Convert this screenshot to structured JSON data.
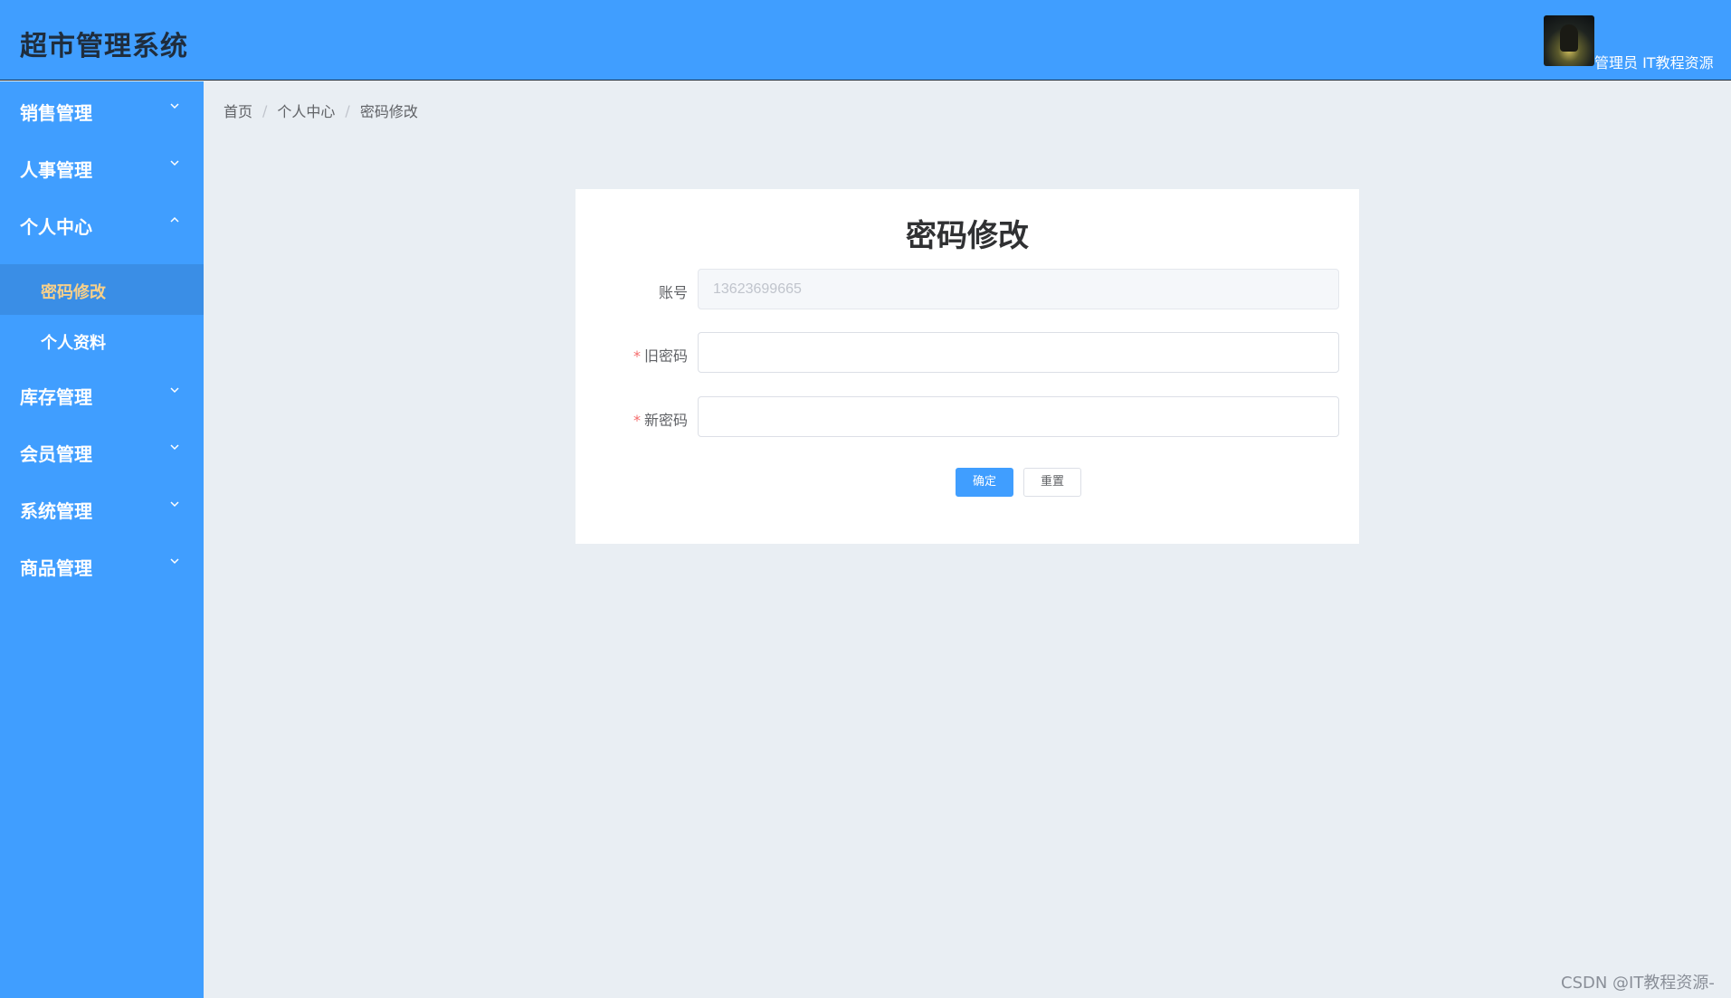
{
  "header": {
    "title": "超市管理系统",
    "user_label": "管理员 IT教程资源"
  },
  "sidebar": {
    "items": [
      {
        "label": "销售管理",
        "expanded": false,
        "icon": "chevron-down-icon"
      },
      {
        "label": "人事管理",
        "expanded": false,
        "icon": "chevron-down-icon"
      },
      {
        "label": "个人中心",
        "expanded": true,
        "icon": "chevron-up-icon",
        "children": [
          {
            "label": "密码修改",
            "active": true
          },
          {
            "label": "个人资料",
            "active": false
          }
        ]
      },
      {
        "label": "库存管理",
        "expanded": false,
        "icon": "chevron-down-icon"
      },
      {
        "label": "会员管理",
        "expanded": false,
        "icon": "chevron-down-icon"
      },
      {
        "label": "系统管理",
        "expanded": false,
        "icon": "chevron-down-icon"
      },
      {
        "label": "商品管理",
        "expanded": false,
        "icon": "chevron-down-icon"
      }
    ]
  },
  "breadcrumb": {
    "items": [
      "首页",
      "个人中心",
      "密码修改"
    ],
    "separator": "/"
  },
  "form": {
    "title": "密码修改",
    "account_label": "账号",
    "account_value": "13623699665",
    "old_password_label": "旧密码",
    "new_password_label": "新密码",
    "required_mark": "*",
    "confirm_label": "确定",
    "reset_label": "重置"
  },
  "watermark": "CSDN @IT教程资源-",
  "colors": {
    "primary": "#409eff",
    "active_menu_text": "#f7d08a",
    "required": "#f56c6c",
    "background": "#e9eef3"
  }
}
